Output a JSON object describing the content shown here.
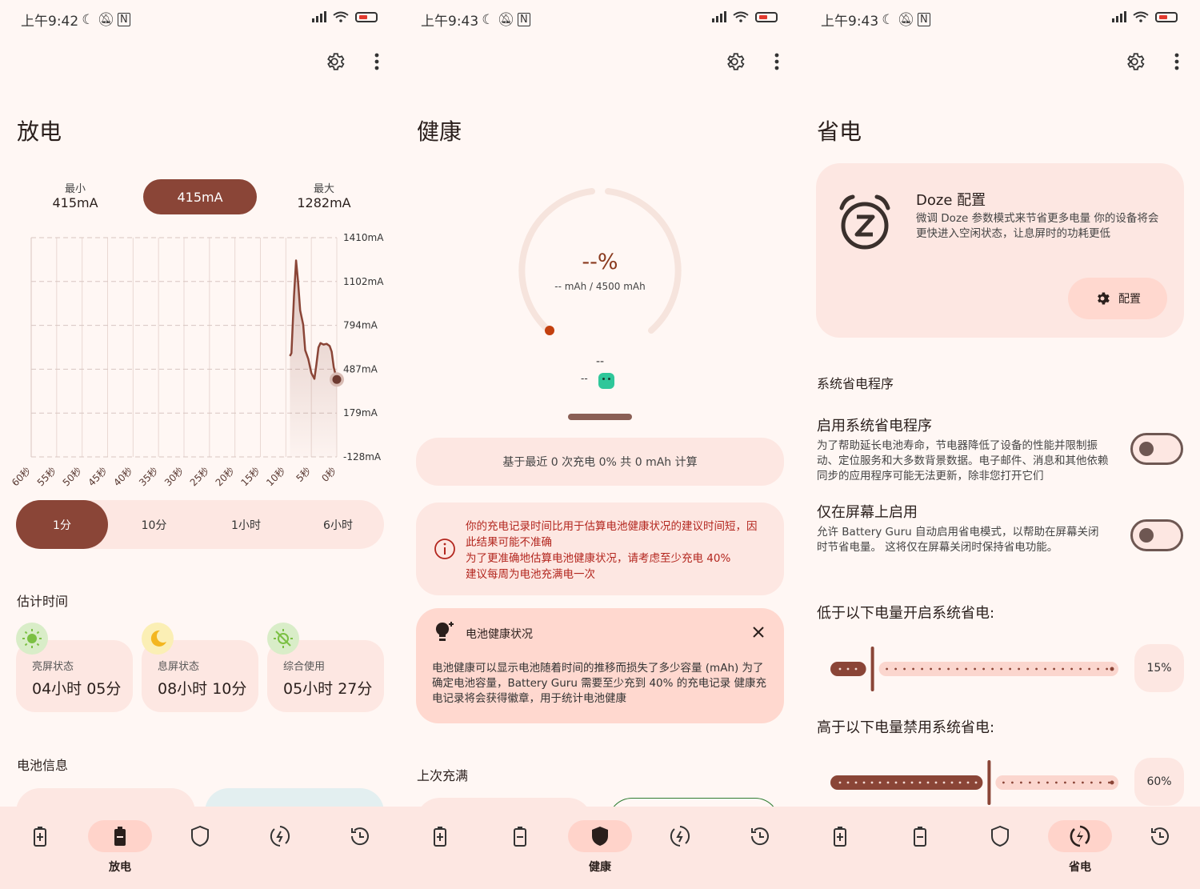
{
  "status_bars": [
    {
      "time": "上午9:42"
    },
    {
      "time": "上午9:43"
    },
    {
      "time": "上午9:43"
    }
  ],
  "colors": {
    "accent": "#8a4537",
    "surface": "#fde7e2",
    "background": "#fff7f4",
    "warning": "#b3261e",
    "track": "#f6e4dd"
  },
  "discharge": {
    "title": "放电",
    "min_label": "最小",
    "min_value": "415mA",
    "current_value": "415mA",
    "max_label": "最大",
    "max_value": "1282mA",
    "ranges": [
      "1分",
      "10分",
      "1小时",
      "6小时"
    ],
    "selected_range": 0,
    "estimate_title": "估计时间",
    "estimates": [
      {
        "label": "亮屏状态",
        "value": "04小时 05分",
        "icon": "sun-icon"
      },
      {
        "label": "息屏状态",
        "value": "08小时 10分",
        "icon": "moon-icon"
      },
      {
        "label": "综合使用",
        "value": "05小时 27分",
        "icon": "sun-off-icon"
      }
    ],
    "battery_info_title": "电池信息"
  },
  "chart_data": {
    "type": "area",
    "y_tick_labels": [
      "1410mA",
      "1102mA",
      "794mA",
      "487mA",
      "179mA",
      "-128mA"
    ],
    "x_tick_labels": [
      "60秒",
      "55秒",
      "50秒",
      "45秒",
      "40秒",
      "35秒",
      "30秒",
      "25秒",
      "20秒",
      "15秒",
      "10秒",
      "5秒",
      "0秒"
    ],
    "ylim": [
      -128,
      1410
    ],
    "xlim": [
      -60,
      0
    ],
    "x": [
      -9.2,
      -8.9,
      -8.4,
      -8.0,
      -7.6,
      -7.2,
      -6.6,
      -6.2,
      -5.6,
      -5.0,
      -4.4,
      -4.0,
      -3.6,
      -3.2,
      -2.6,
      -2.0,
      -1.4,
      -1.0,
      -0.6,
      0
    ],
    "values": [
      580,
      600,
      1000,
      1250,
      1100,
      900,
      800,
      620,
      560,
      460,
      420,
      520,
      640,
      670,
      660,
      665,
      650,
      610,
      500,
      415
    ],
    "grid": true
  },
  "health": {
    "title": "健康",
    "percent": "--%",
    "capacity": "-- mAh / 4500 mAh",
    "dash_top": "--",
    "dash_left": "--",
    "basis": "基于最近 0 次充电 0% 共 0 mAh 计算",
    "warning_lines": [
      "你的充电记录时间比用于估算电池健康状况的建议时间短，因此结果可能不准确",
      "为了更准确地估算电池健康状况，请考虑至少充电 40%",
      "建议每周为电池充满电一次"
    ],
    "info_title": "电池健康状况",
    "info_body": "电池健康可以显示电池随着时间的推移而损失了多少容量 (mAh) 为了确定电池容量，Battery Guru 需要至少充到 40% 的充电记录 健康充电记录将会获得徽章，用于统计电池健康",
    "last_full_title": "上次充满"
  },
  "saver": {
    "title": "省电",
    "doze_title": "Doze 配置",
    "doze_desc": "微调 Doze 参数模式来节省更多电量 你的设备将会更快进入空闲状态，让息屏时的功耗更低",
    "doze_button": "配置",
    "section_title": "系统省电程序",
    "enable_title": "启用系统省电程序",
    "enable_desc": "为了帮助延长电池寿命，节电器降低了设备的性能并限制振动、定位服务和大多数背景数据。电子邮件、消息和其他依赖同步的应用程序可能无法更新，除非您打开它们",
    "screen_title": "仅在屏幕上启用",
    "screen_desc": "允许 Battery Guru 自动启用省电模式，以帮助在屏幕关闭时节省电量。 这将仅在屏幕关闭时保持省电功能。",
    "low_title": "低于以下电量开启系统省电:",
    "low_value": "15%",
    "low_level": 0.15,
    "high_title": "高于以下电量禁用系统省电:",
    "high_value": "60%",
    "high_level": 0.6
  },
  "nav": {
    "discharge_label": "放电",
    "health_label": "健康",
    "saver_label": "省电"
  }
}
